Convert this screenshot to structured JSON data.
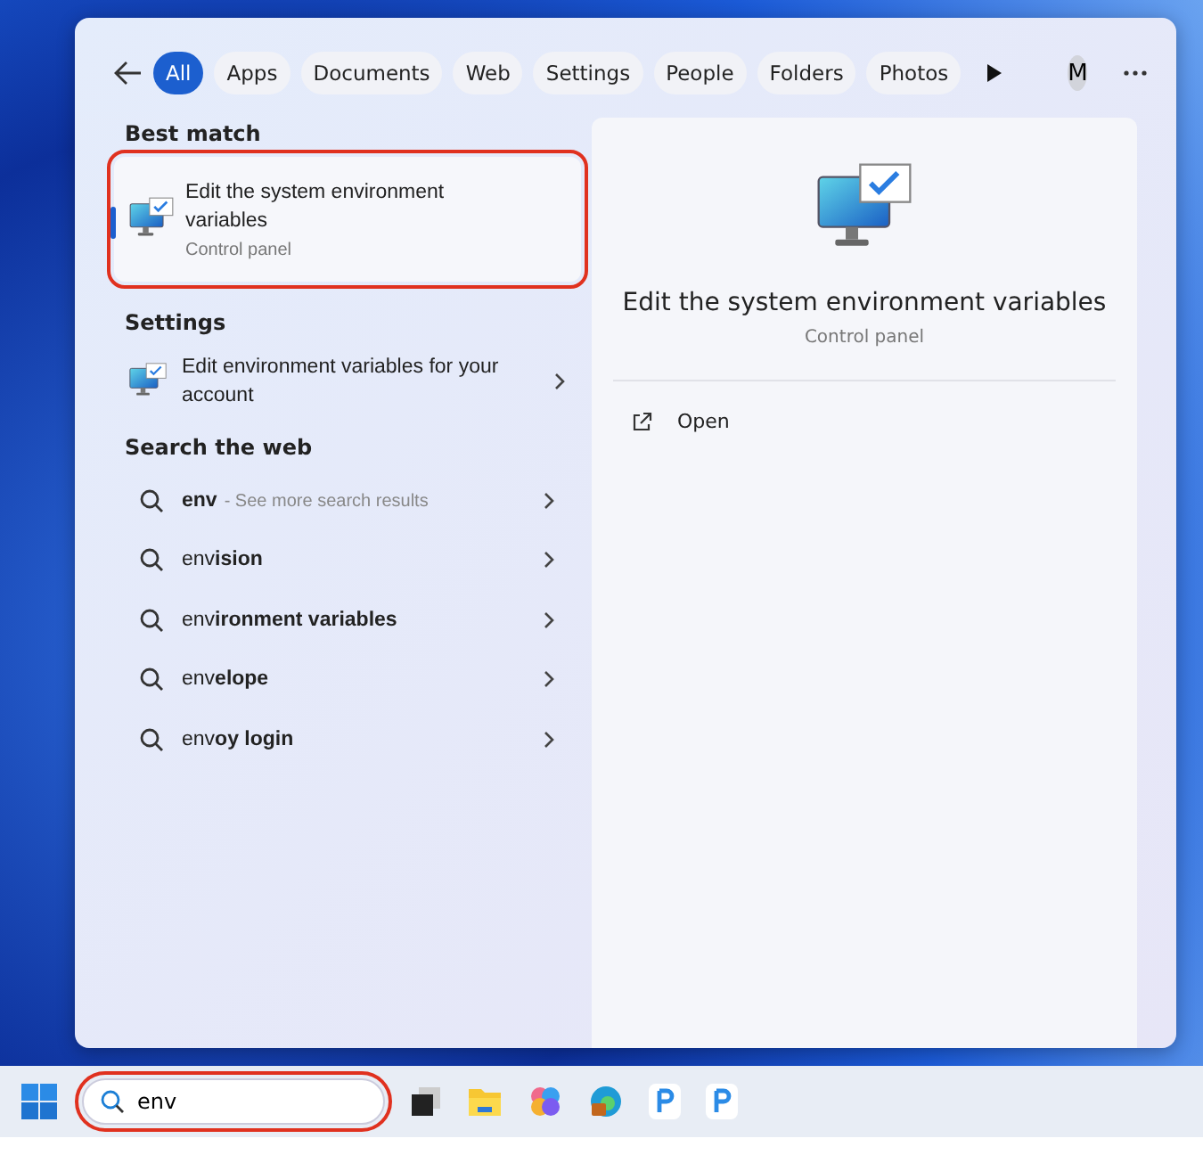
{
  "filters": [
    {
      "label": "All",
      "selected": true
    },
    {
      "label": "Apps",
      "selected": false
    },
    {
      "label": "Documents",
      "selected": false
    },
    {
      "label": "Web",
      "selected": false
    },
    {
      "label": "Settings",
      "selected": false
    },
    {
      "label": "People",
      "selected": false
    },
    {
      "label": "Folders",
      "selected": false
    },
    {
      "label": "Photos",
      "selected": false
    }
  ],
  "account_initial": "M",
  "best_match": {
    "heading": "Best match",
    "title": "Edit the system environment variables",
    "subtitle": "Control panel",
    "selected": true,
    "highlighted": true
  },
  "settings": {
    "heading": "Settings",
    "items": [
      {
        "title": "Edit environment variables for your account"
      }
    ]
  },
  "web": {
    "heading": "Search the web",
    "items": [
      {
        "text": "**env**",
        "hint": "- See more search results"
      },
      {
        "text": "env**ision**"
      },
      {
        "text": "env**ironment variables**"
      },
      {
        "text": "env**elope**"
      },
      {
        "text": "env**oy login**"
      }
    ]
  },
  "detail": {
    "title": "Edit the system environment variables",
    "subtitle": "Control panel",
    "actions": [
      {
        "label": "Open"
      }
    ]
  },
  "taskbar": {
    "search": {
      "value": "env",
      "highlighted": true
    }
  }
}
